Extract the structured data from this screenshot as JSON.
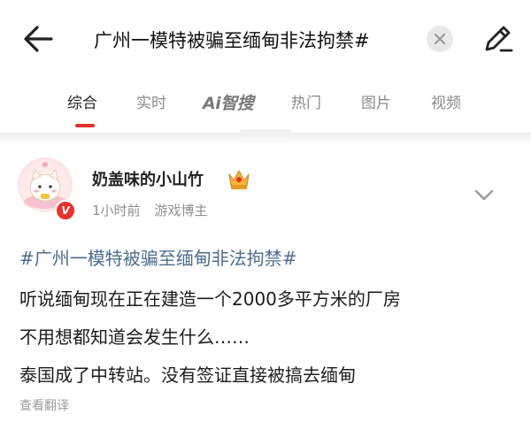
{
  "header": {
    "query": "广州一模特被骗至缅甸非法拘禁#",
    "back_icon": "arrow-left-icon",
    "clear_icon": "close-icon",
    "edit_icon": "pencil-icon"
  },
  "tabs": [
    {
      "label": "综合",
      "active": true
    },
    {
      "label": "实时",
      "active": false
    },
    {
      "label": "Ai智搜",
      "active": false
    },
    {
      "label": "热门",
      "active": false
    },
    {
      "label": "图片",
      "active": false
    },
    {
      "label": "视频",
      "active": false
    }
  ],
  "post": {
    "author": "奶盖味的小山竹",
    "verified_badge": "V",
    "time": "1小时前",
    "tag": "游戏博主",
    "topic": "#广州一模特被骗至缅甸非法拘禁#",
    "lines": [
      "听说缅甸现在正在建造一个2000多平方米的厂房",
      "不用想都知道会发生什么……",
      "泰国成了中转站。没有签证直接被搞去缅甸"
    ],
    "translate": "查看翻译"
  },
  "colors": {
    "accent": "#e0322b",
    "topic_link": "#4b6c92",
    "muted": "#8e8e8e"
  }
}
